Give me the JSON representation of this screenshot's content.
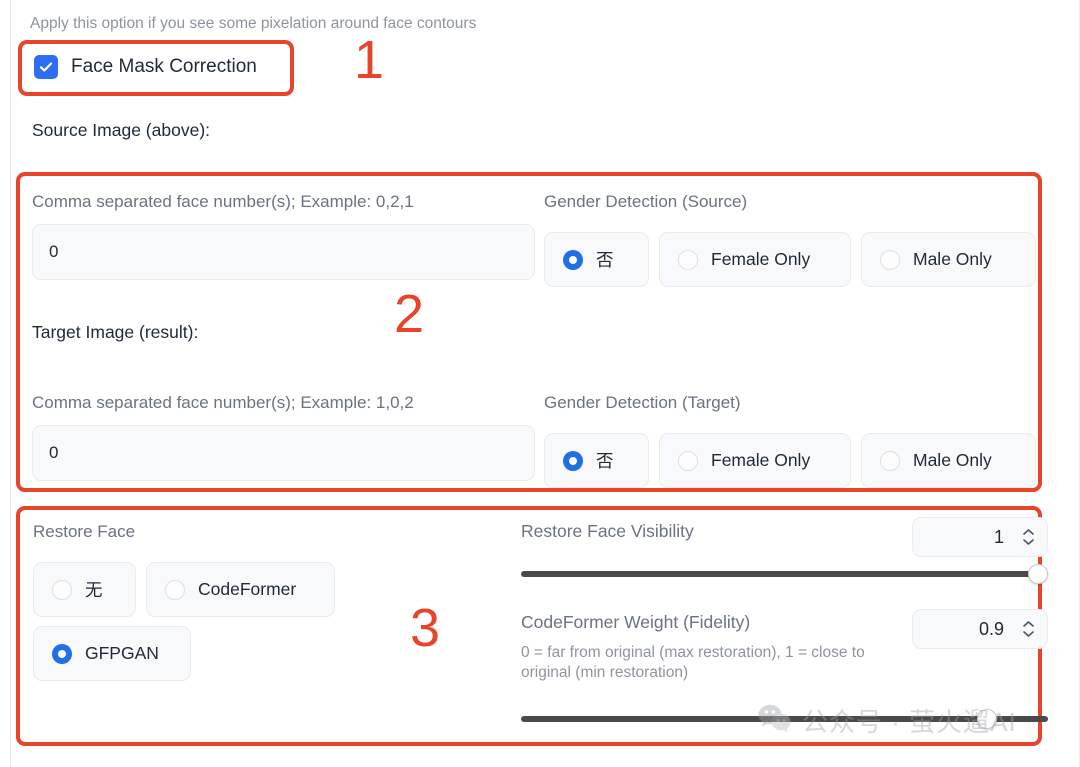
{
  "hint_text": "Apply this option if you see some pixelation around face contours",
  "checkbox": {
    "label": "Face Mask Correction",
    "checked": true,
    "icon": "check-icon"
  },
  "sections": {
    "source": {
      "heading": "Source Image (above):",
      "face_numbers": {
        "label": "Comma separated face number(s); Example: 0,2,1",
        "value": "0"
      },
      "gender_detection": {
        "label": "Gender Detection (Source)",
        "options": [
          "否",
          "Female Only",
          "Male Only"
        ],
        "selected": "否"
      }
    },
    "target": {
      "heading": "Target Image (result):",
      "face_numbers": {
        "label": "Comma separated face number(s); Example: 1,0,2",
        "value": "0"
      },
      "gender_detection": {
        "label": "Gender Detection (Target)",
        "options": [
          "否",
          "Female Only",
          "Male Only"
        ],
        "selected": "否"
      }
    },
    "restore": {
      "label": "Restore Face",
      "options": [
        "无",
        "CodeFormer",
        "GFPGAN"
      ],
      "selected": "GFPGAN",
      "visibility": {
        "label": "Restore Face Visibility",
        "value": "1",
        "min": 0,
        "max": 1,
        "percent": 100
      },
      "codeformer_weight": {
        "label": "CodeFormer Weight (Fidelity)",
        "value": "0.9",
        "help": "0 = far from original (max restoration), 1 = close to original (min restoration)",
        "min": 0,
        "max": 1,
        "percent": 90
      }
    }
  },
  "annotations": [
    {
      "number": "1"
    },
    {
      "number": "2"
    },
    {
      "number": "3"
    }
  ],
  "watermark": {
    "text": "公众号 · 萤火遛AI",
    "icon": "wechat-icon"
  },
  "colors": {
    "annotation_red": "#e8442a",
    "accent_blue": "#2e6df6",
    "radio_blue": "#1f6feb",
    "slider_track": "#4a4a4a"
  }
}
